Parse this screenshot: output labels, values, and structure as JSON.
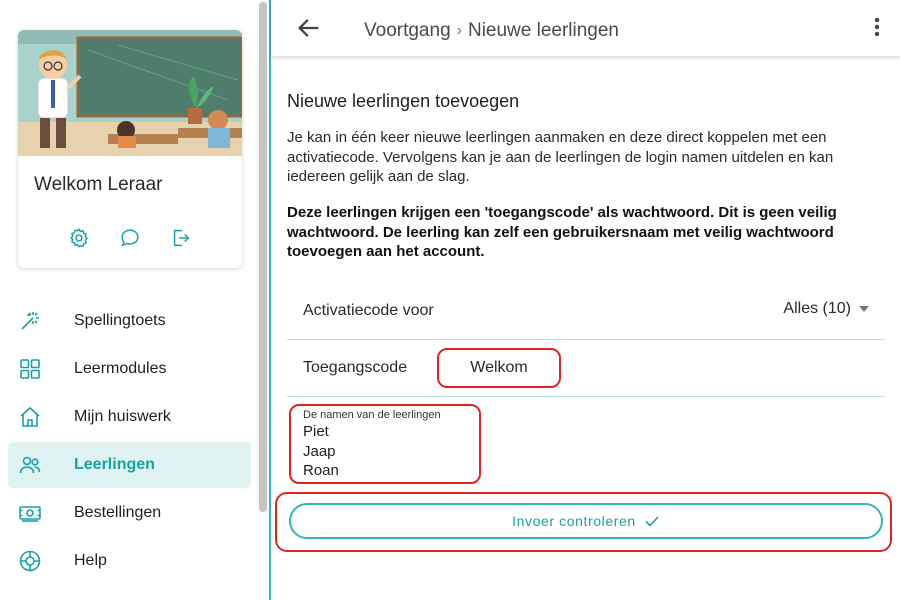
{
  "sidebar": {
    "welcome": "Welkom Leraar",
    "card_actions": [
      {
        "icon": "gear-icon"
      },
      {
        "icon": "chat-icon"
      },
      {
        "icon": "logout-icon"
      }
    ],
    "items": [
      {
        "label": "Spellingtoets",
        "icon": "magic-wand-icon",
        "active": false
      },
      {
        "label": "Leermodules",
        "icon": "grid-icon",
        "active": false
      },
      {
        "label": "Mijn huiswerk",
        "icon": "home-icon",
        "active": false
      },
      {
        "label": "Leerlingen",
        "icon": "users-icon",
        "active": true
      },
      {
        "label": "Bestellingen",
        "icon": "money-icon",
        "active": false
      },
      {
        "label": "Help",
        "icon": "lifebuoy-icon",
        "active": false
      }
    ]
  },
  "header": {
    "breadcrumb_parent": "Voortgang",
    "breadcrumb_separator": "›",
    "breadcrumb_current": "Nieuwe leerlingen"
  },
  "main": {
    "title": "Nieuwe leerlingen toevoegen",
    "intro": "Je kan in één keer nieuwe leerlingen aanmaken en deze direct koppelen met een activatiecode. Vervolgens kan je aan de leerlingen de login namen uitdelen en kan iedereen gelijk aan de slag.",
    "warning": "Deze leerlingen krijgen een 'toegangscode' als wachtwoord. Dit is geen veilig wachtwoord. De leerling kan zelf een gebruikersnaam met veilig wachtwoord toevoegen aan het account.",
    "activation_label": "Activatiecode voor",
    "activation_value": "Alles (10)",
    "access_label": "Toegangscode",
    "access_value": "Welkom",
    "names_caption": "De namen van de leerlingen",
    "names": [
      "Piet",
      "Jaap",
      "Roan"
    ],
    "submit_label": "Invoer controleren"
  },
  "colors": {
    "accent": "#17a2a2",
    "accent_border": "#35b5b5",
    "active_bg": "#dff3f3",
    "highlight": "#e02424"
  }
}
